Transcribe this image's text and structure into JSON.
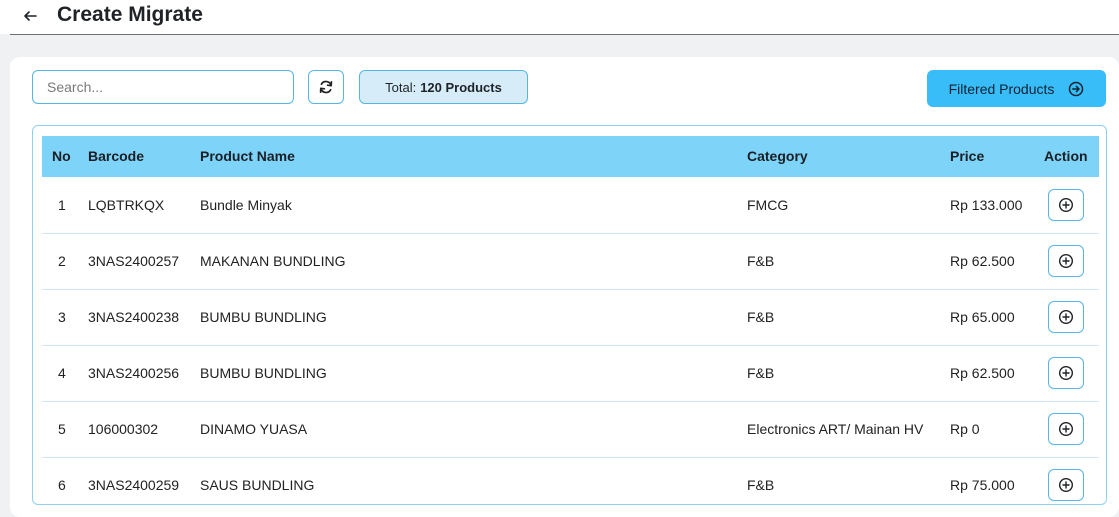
{
  "header": {
    "title": "Create Migrate",
    "back_icon": "arrow-left-icon"
  },
  "toolbar": {
    "search_placeholder": "Search...",
    "search_value": "",
    "refresh_icon": "refresh-icon",
    "total_prefix": "Total:",
    "total_value": "120 Products",
    "filtered_label": "Filtered Products",
    "filtered_icon": "arrow-right-circle-icon"
  },
  "table": {
    "columns": [
      "No",
      "Barcode",
      "Product Name",
      "Category",
      "Price",
      "Action"
    ],
    "rows": [
      {
        "no": "1",
        "barcode": "LQBTRKQX",
        "name": "Bundle Minyak",
        "category": "FMCG",
        "price": "Rp 133.000"
      },
      {
        "no": "2",
        "barcode": "3NAS2400257",
        "name": "MAKANAN BUNDLING",
        "category": "F&B",
        "price": "Rp 62.500"
      },
      {
        "no": "3",
        "barcode": "3NAS2400238",
        "name": "BUMBU BUNDLING",
        "category": "F&B",
        "price": "Rp 65.000"
      },
      {
        "no": "4",
        "barcode": "3NAS2400256",
        "name": "BUMBU BUNDLING",
        "category": "F&B",
        "price": "Rp 62.500"
      },
      {
        "no": "5",
        "barcode": "106000302",
        "name": "DINAMO YUASA",
        "category": "Electronics ART/ Mainan HV",
        "price": "Rp 0"
      },
      {
        "no": "6",
        "barcode": "3NAS2400259",
        "name": "SAUS BUNDLING",
        "category": "F&B",
        "price": "Rp 75.000"
      }
    ],
    "action_icon": "plus-circle-icon"
  },
  "colors": {
    "accent": "#38bdf8",
    "header_row": "#7dd3f8",
    "border": "#55b6e6",
    "badge_bg": "#d6edf9"
  }
}
